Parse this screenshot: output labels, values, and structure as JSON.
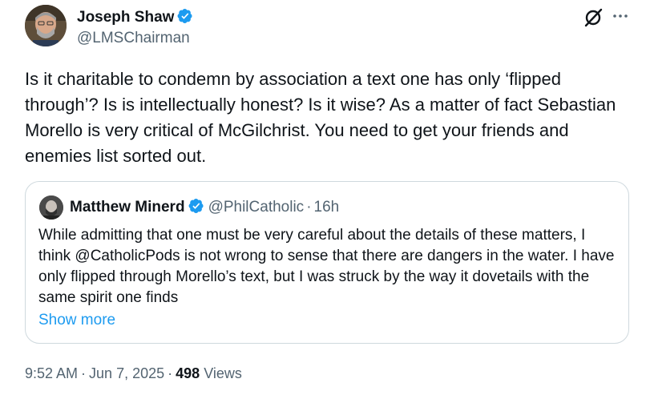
{
  "author": {
    "name": "Joseph Shaw",
    "handle": "@LMSChairman"
  },
  "tweet": {
    "text": "Is it charitable to condemn by association a text one has only ‘flipped through’? Is is intellectually honest? Is it wise? As a matter of fact Sebastian Morello is very critical of McGilchrist. You need to get your friends and enemies list sorted out."
  },
  "quoted": {
    "name": "Matthew Minerd",
    "handle": "@PhilCatholic",
    "separator": "·",
    "time": "16h",
    "text": "While admitting that one must be very careful about the details of these matters, I think @CatholicPods  is not wrong to sense that there are dangers in the water. I have only flipped through Morello’s text, but I was struck by the way it dovetails with the same spirit one finds",
    "show_more": "Show more"
  },
  "footer": {
    "time": "9:52 AM",
    "date": "Jun 7, 2025",
    "separator": "·",
    "views_count": "498",
    "views_label": "Views"
  },
  "colors": {
    "verified": "#1d9bf0",
    "link": "#1d9bf0",
    "secondary_text": "#536471",
    "border": "#cfd9de"
  },
  "icons": {
    "verified": "verified-badge-icon",
    "grok": "grok-icon",
    "more": "more-icon"
  }
}
